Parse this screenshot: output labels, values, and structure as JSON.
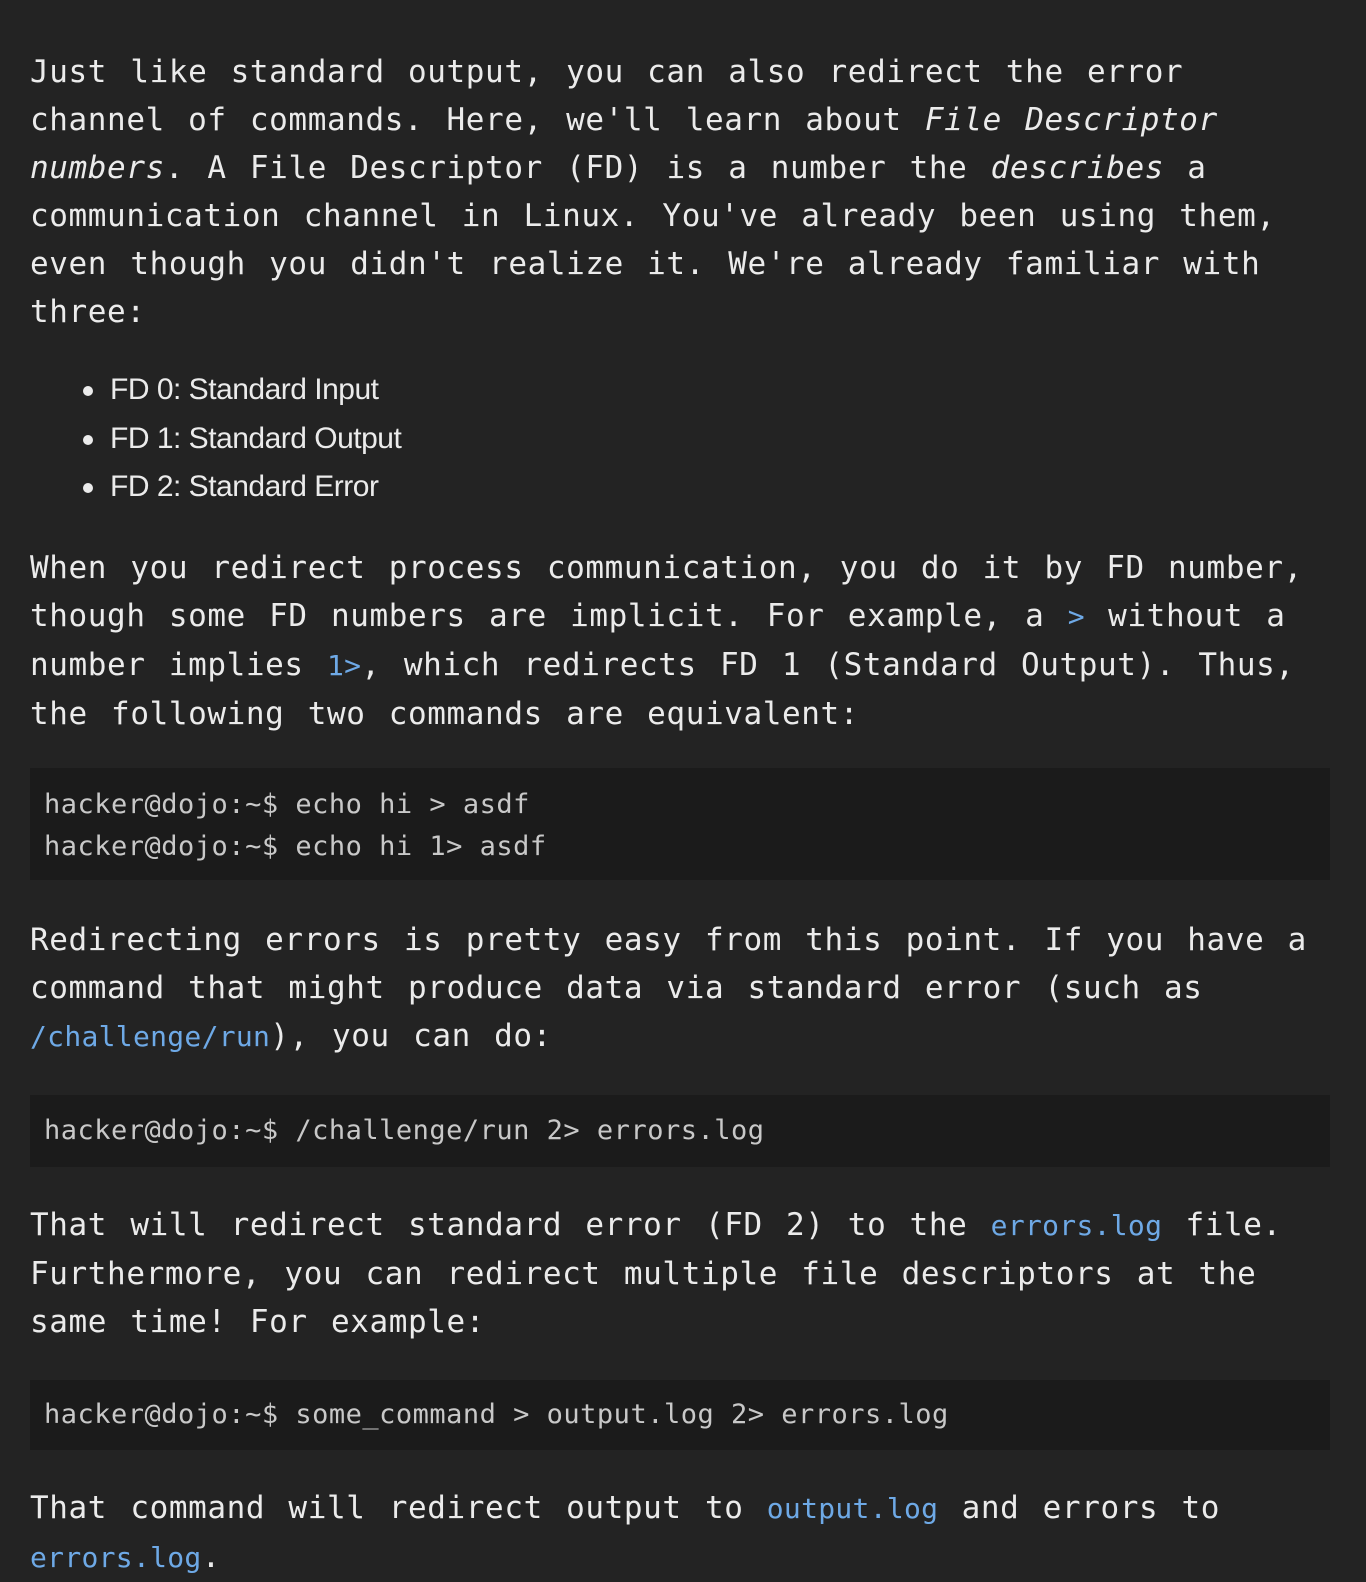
{
  "paragraph_1": {
    "part_a": "Just like standard output, you can also redirect the error channel of commands. Here, we'll learn about ",
    "em_a": "File Descriptor numbers",
    "part_b": ". A File Descriptor (FD) is a number the ",
    "em_b": "describes",
    "part_c": " a communication channel in Linux. You've already been using them, even though you didn't realize it. We're already familiar with three:"
  },
  "fd_list": [
    "FD 0: Standard Input",
    "FD 1: Standard Output",
    "FD 2: Standard Error"
  ],
  "paragraph_2": {
    "part_a": "When you redirect process communication, you do it by FD number, though some FD numbers are implicit. For example, a ",
    "code_a": ">",
    "part_b": " without a number implies ",
    "code_b": "1>",
    "part_c": ", which redirects FD 1 (Standard Output). Thus, the following two commands are equivalent:"
  },
  "code_block_1": [
    "hacker@dojo:~$ echo hi > asdf",
    "hacker@dojo:~$ echo hi 1> asdf"
  ],
  "paragraph_3": {
    "part_a": "Redirecting errors is pretty easy from this point. If you have a command that might produce data via standard error (such as ",
    "code_a": "/challenge/run",
    "part_b": "), you can do:"
  },
  "code_block_2": [
    "hacker@dojo:~$ /challenge/run 2> errors.log"
  ],
  "paragraph_4": {
    "part_a": "That will redirect standard error (FD 2) to the ",
    "code_a": "errors.log",
    "part_b": " file. Furthermore, you can redirect multiple file descriptors at the same time! For example:"
  },
  "code_block_3": [
    "hacker@dojo:~$ some_command > output.log 2> errors.log"
  ],
  "paragraph_5": {
    "part_a": "That command will redirect output to ",
    "code_a": "output.log",
    "part_b": " and errors to ",
    "code_b": "errors.log",
    "part_c": "."
  },
  "colors": {
    "background": "#232323",
    "text": "#ebebeb",
    "code_block_background": "#1b1b1b",
    "code_block_text": "#c8c8c8",
    "inline_code": "#6ea9e6"
  }
}
